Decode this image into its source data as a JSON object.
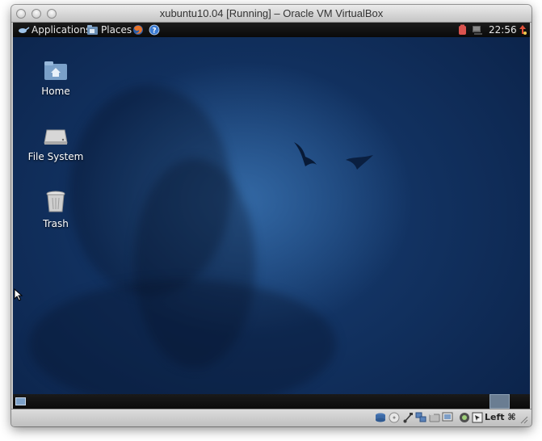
{
  "window": {
    "title": "xubuntu10.04 [Running] – Oracle VM VirtualBox"
  },
  "top_panel": {
    "applications_label": "Applications",
    "places_label": "Places",
    "clock": "22:56"
  },
  "desktop": {
    "icons": [
      {
        "label": "Home",
        "icon": "folder-home-icon"
      },
      {
        "label": "File System",
        "icon": "drive-icon"
      },
      {
        "label": "Trash",
        "icon": "trash-icon"
      }
    ]
  },
  "statusbar": {
    "host_key": "Left ⌘"
  }
}
